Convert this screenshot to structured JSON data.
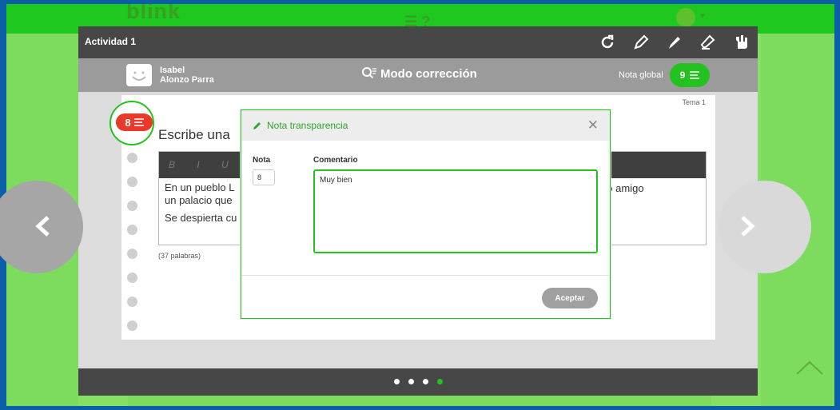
{
  "app": {
    "brand": "blink"
  },
  "activity": {
    "title": "Actividad 1"
  },
  "student": {
    "first": "Isabel",
    "last": "Alonzo Parra"
  },
  "mode": {
    "label": "Modo corrección"
  },
  "global_grade": {
    "label": "Nota global",
    "value": "9"
  },
  "sheet": {
    "tema": "Tema 1",
    "heading": "Escribe una",
    "editor_buttons": "B I U S",
    "text_line1": "En un pueblo L",
    "text_line1b": "un palacio que",
    "text_line2": "Se despierta cu",
    "text_right": "ro amigo",
    "word_count": "(37 palabras)"
  },
  "grade_badge": {
    "value": "8"
  },
  "modal": {
    "title": "Nota transparencia",
    "nota_label": "Nota",
    "nota_value": "8",
    "comment_label": "Comentario",
    "comment_value": "Muy bien",
    "accept_label": "Aceptar"
  },
  "pager": {
    "total": 4,
    "active": 4
  },
  "colors": {
    "accent": "#23c21e",
    "badge": "#e8392b",
    "bar": "#474747",
    "background": "#7ddb5d"
  }
}
